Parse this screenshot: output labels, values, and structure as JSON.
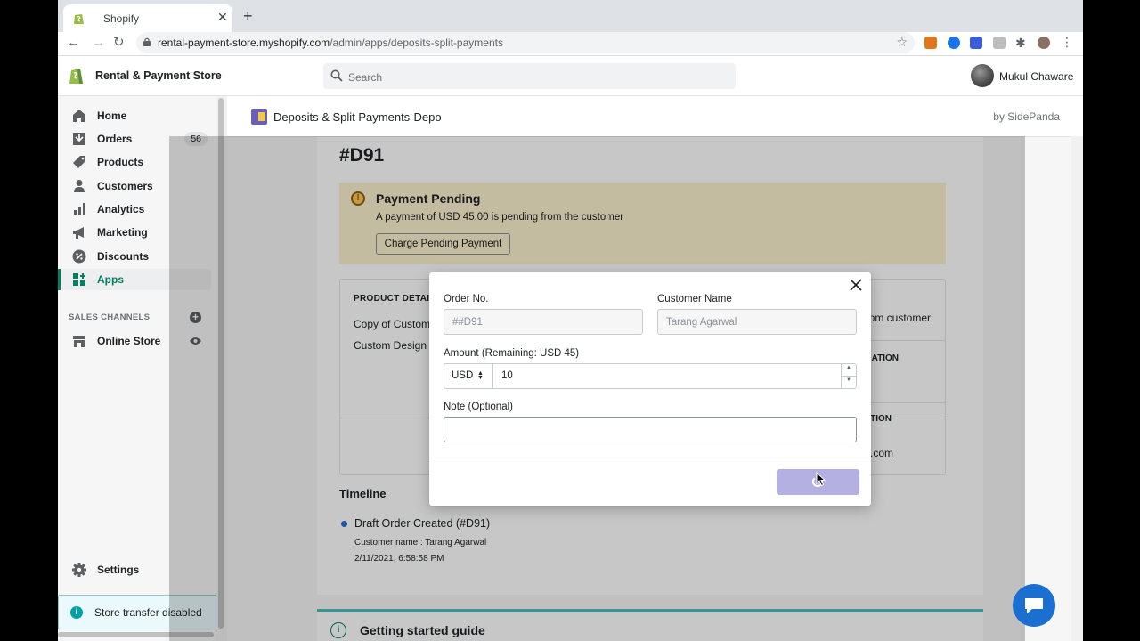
{
  "browser": {
    "tab_title": "Shopify",
    "url_host": "rental-payment-store.myshopify.com",
    "url_path": "/admin/apps/deposits-split-payments"
  },
  "topbar": {
    "store_name": "Rental & Payment Store",
    "search_placeholder": "Search",
    "user_name": "Mukul Chaware"
  },
  "sidebar": {
    "items": [
      {
        "label": "Home",
        "icon": "home-icon"
      },
      {
        "label": "Orders",
        "icon": "orders-icon",
        "badge": "56"
      },
      {
        "label": "Products",
        "icon": "tag-icon"
      },
      {
        "label": "Customers",
        "icon": "person-icon"
      },
      {
        "label": "Analytics",
        "icon": "bar-chart-icon"
      },
      {
        "label": "Marketing",
        "icon": "megaphone-icon"
      },
      {
        "label": "Discounts",
        "icon": "discount-icon"
      },
      {
        "label": "Apps",
        "icon": "apps-icon",
        "active": true
      }
    ],
    "sales_channels_label": "SALES CHANNELS",
    "online_store_label": "Online Store",
    "settings_label": "Settings",
    "store_transfer": "Store transfer disabled"
  },
  "app": {
    "title": "Deposits & Split Payments-Depo",
    "by": "by SidePanda"
  },
  "order": {
    "title": "#D91",
    "banner_heading": "Payment Pending",
    "banner_text": "A payment of USD 45.00 is pending from the customer",
    "banner_button": "Charge Pending Payment",
    "product_details_label": "PRODUCT DETAIL",
    "product_line_1": "Copy of Custom",
    "product_line_2": "Custom Design",
    "right_line_1": "om customer",
    "right_label_2": "ATION",
    "right_label_3": "TION",
    "right_line_4": ".com",
    "timeline_heading": "Timeline",
    "timeline_event": "Draft Order Created (#D91)",
    "timeline_customer": "Customer name : Tarang Agarwal",
    "timeline_date": "2/11/2021, 6:58:58 PM",
    "guide_title": "Getting started guide"
  },
  "modal": {
    "order_no_label": "Order No.",
    "order_no_value": "##D91",
    "customer_name_label": "Customer Name",
    "customer_name_value": "Tarang Agarwal",
    "amount_label": "Amount (Remaining: USD 45)",
    "currency": "USD",
    "amount_value": "10",
    "note_label": "Note (Optional)",
    "note_value": ""
  },
  "colors": {
    "accent_green": "#008060",
    "banner_yellow": "#fcf1cd",
    "submit_loading": "#b4b0e2",
    "chat_blue": "#1b6fd1"
  }
}
